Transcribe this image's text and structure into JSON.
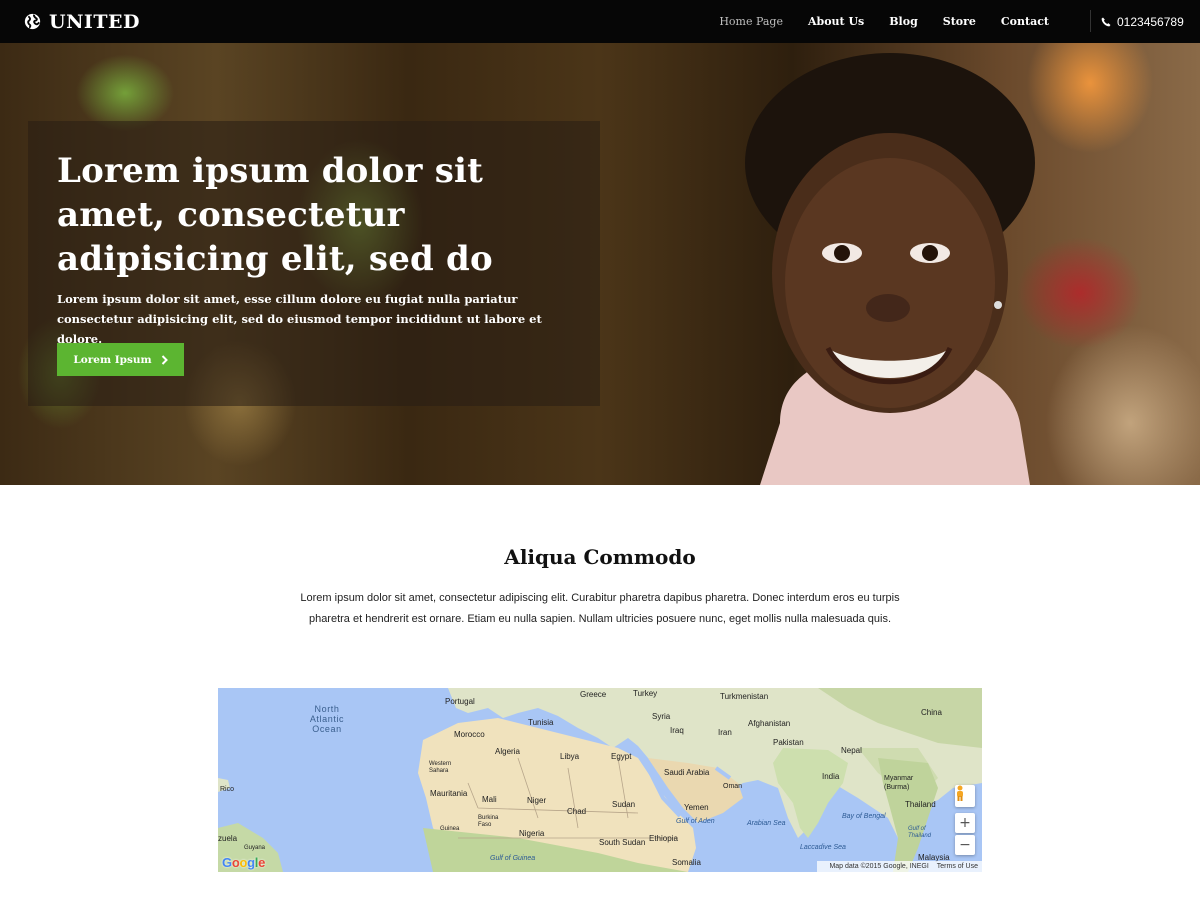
{
  "brand": {
    "name": "UNITED",
    "icon": "globe-icon"
  },
  "nav": {
    "items": [
      {
        "label": "Home Page",
        "active": true
      },
      {
        "label": "About Us",
        "active": false
      },
      {
        "label": "Blog",
        "active": false
      },
      {
        "label": "Store",
        "active": false
      },
      {
        "label": "Contact",
        "active": false
      }
    ],
    "phone": "0123456789",
    "phone_icon": "phone-icon"
  },
  "hero": {
    "title": "Lorem ipsum dolor sit amet, consectetur adipisicing elit, sed do",
    "subtitle": "Lorem ipsum dolor sit amet, esse cillum dolore eu fugiat nulla pariatur consectetur adipisicing elit, sed do eiusmod tempor incididunt ut labore et dolore.",
    "button_label": "Lorem Ipsum",
    "button_icon": "chevron-right-icon",
    "button_color": "#5cb531"
  },
  "section": {
    "title": "Aliqua Commodo",
    "text": "Lorem ipsum dolor sit amet, consectetur adipiscing elit. Curabitur pharetra dapibus pharetra. Donec interdum eros eu turpis pharetra et hendrerit est ornare. Etiam eu nulla sapien. Nullam ultricies posuere nunc, eget mollis nulla malesuada quis."
  },
  "map": {
    "ocean_label": "North Atlantic Ocean",
    "labels": {
      "portugal": "Portugal",
      "greece": "Greece",
      "turkey": "Turkey",
      "turkmenistan": "Turkmenistan",
      "china": "China",
      "tunisia": "Tunisia",
      "syria": "Syria",
      "afghanistan": "Afghanistan",
      "morocco": "Morocco",
      "iraq": "Iraq",
      "iran": "Iran",
      "pakistan": "Pakistan",
      "algeria": "Algeria",
      "libya": "Libya",
      "egypt": "Egypt",
      "nepal": "Nepal",
      "western_sahara": "Western Sahara",
      "saudi_arabia": "Saudi Arabia",
      "india": "India",
      "myanmar": "Myanmar (Burma)",
      "mauritania": "Mauritania",
      "mali": "Mali",
      "niger": "Niger",
      "oman": "Oman",
      "rico": "Rico",
      "chad": "Chad",
      "sudan": "Sudan",
      "yemen": "Yemen",
      "thailand": "Thailand",
      "burkina": "Burkina Faso",
      "gulf_aden": "Gulf of Aden",
      "arabian_sea": "Arabian Sea",
      "bay_bengal": "Bay of Bengal",
      "gulf_thailand": "Gulf of Thailand",
      "zuela": "zuela",
      "guinea": "Guinea",
      "nigeria": "Nigeria",
      "ethiopia": "Ethiopia",
      "guyana": "Guyana",
      "south_sudan": "South Sudan",
      "laccadive": "Laccadive Sea",
      "gulf_guinea": "Gulf of Guinea",
      "somalia": "Somalia",
      "malaysia": "Malaysia"
    },
    "zoom_in": "+",
    "zoom_out": "−",
    "attribution": "Map data ©2015 Google, INEGI",
    "terms": "Terms of Use",
    "logo": "Google",
    "pegman_icon": "pegman-icon"
  }
}
